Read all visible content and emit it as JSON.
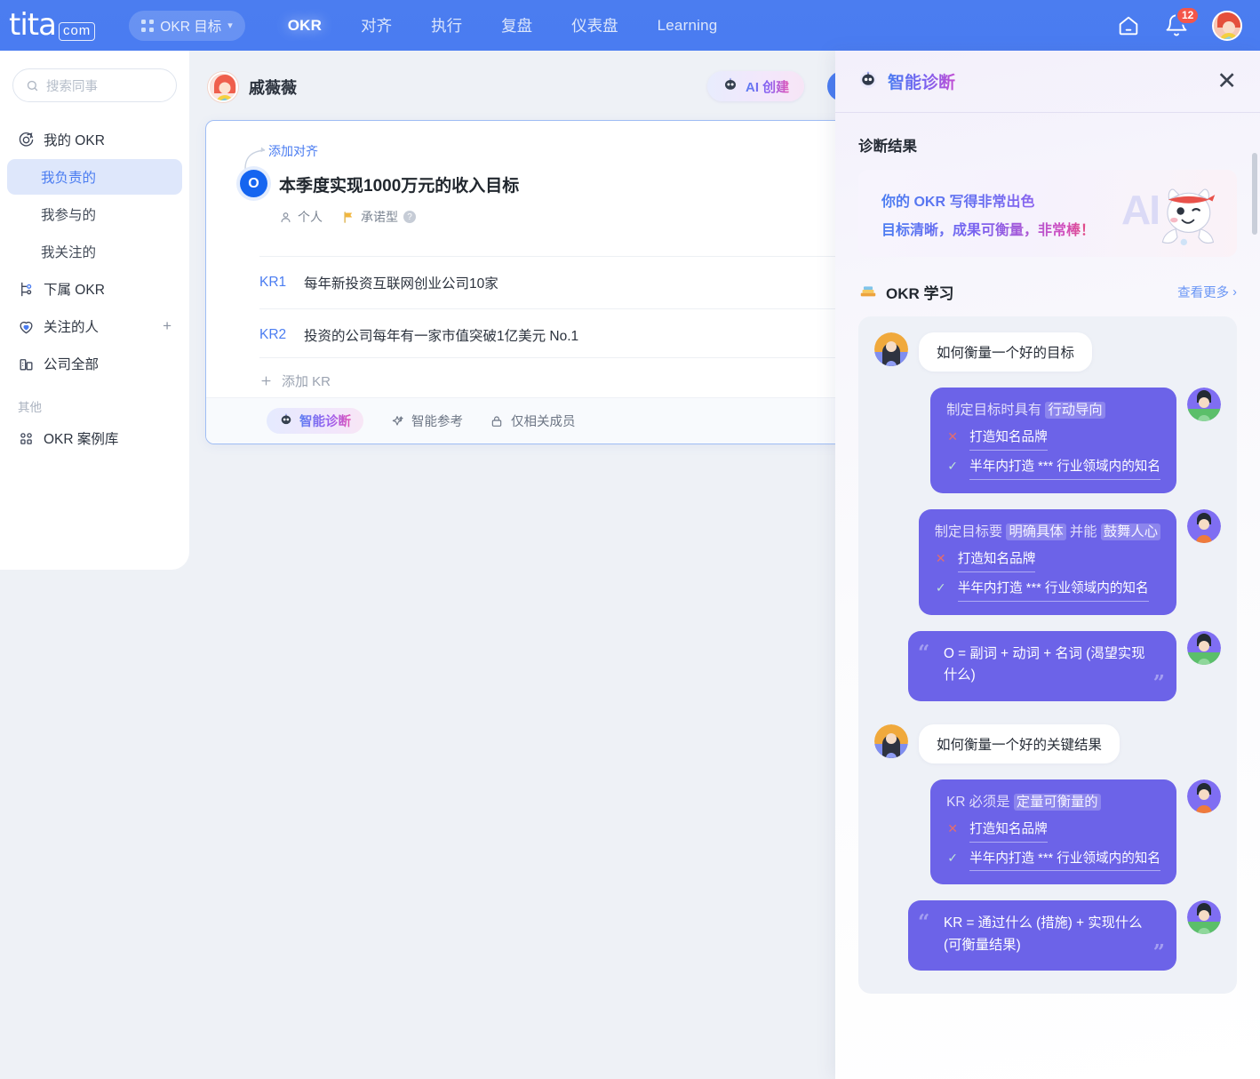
{
  "topnav": {
    "logo_word": "tita",
    "logo_com": "com",
    "okr_target_chip": "OKR 目标",
    "links": [
      {
        "label": "OKR",
        "active": true,
        "latin": true
      },
      {
        "label": "对齐",
        "active": false,
        "latin": false
      },
      {
        "label": "执行",
        "active": false,
        "latin": false
      },
      {
        "label": "复盘",
        "active": false,
        "latin": false
      },
      {
        "label": "仪表盘",
        "active": false,
        "latin": false
      },
      {
        "label": "Learning",
        "active": false,
        "latin": true
      }
    ],
    "notification_count": "12"
  },
  "sidebar": {
    "search_placeholder": "搜索同事",
    "items": [
      {
        "label": "我的 OKR",
        "icon": "target-icon",
        "sub": false,
        "active": false
      },
      {
        "label": "我负责的",
        "icon": "",
        "sub": true,
        "active": true
      },
      {
        "label": "我参与的",
        "icon": "",
        "sub": true,
        "active": false
      },
      {
        "label": "我关注的",
        "icon": "",
        "sub": true,
        "active": false
      },
      {
        "label": "下属 OKR",
        "icon": "org-tree-icon",
        "sub": false,
        "active": false
      },
      {
        "label": "关注的人",
        "icon": "heart-shield-icon",
        "sub": false,
        "active": false,
        "plus": "+"
      },
      {
        "label": "公司全部",
        "icon": "building-icon",
        "sub": false,
        "active": false
      }
    ],
    "section_other": "其他",
    "other_items": [
      {
        "label": "OKR 案例库",
        "icon": "grid-icon"
      }
    ]
  },
  "main": {
    "owner_name": "戚薇薇",
    "ai_create_label": "AI 创建",
    "card": {
      "add_align": "添加对齐",
      "o_badge": "O",
      "objective": "本季度实现1000万元的收入目标",
      "meta": [
        {
          "icon": "person-icon",
          "label": "个人"
        },
        {
          "icon": "flag-icon",
          "label": "承诺型",
          "help": "?"
        }
      ],
      "krs": [
        {
          "tag": "KR1",
          "text": "每年新投资互联网创业公司10家"
        },
        {
          "tag": "KR2",
          "text": "投资的公司每年有一家市值突破1亿美元 No.1"
        }
      ],
      "add_kr": "添加 KR",
      "footer": [
        {
          "label": "智能诊断",
          "icon": "robot-icon",
          "highlight": true
        },
        {
          "label": "智能参考",
          "icon": "sparkle-icon",
          "highlight": false
        },
        {
          "label": "仅相关成员",
          "icon": "lock-icon",
          "highlight": false
        }
      ]
    }
  },
  "panel": {
    "title": "智能诊断",
    "close": "✕",
    "result_title": "诊断结果",
    "diagnosis": {
      "line1": "你的 OKR 写得非常出色",
      "line2": "目标清晰，成果可衡量，非常棒！",
      "ghost_text": "AI"
    },
    "learning": {
      "title": "OKR 学习",
      "more": "查看更多",
      "chat": [
        {
          "type": "question",
          "text": "如何衡量一个好的目标"
        },
        {
          "type": "answer",
          "headline_pre": "制定目标时具有 ",
          "headline_hl": "行动导向",
          "headline_post": "",
          "items": [
            {
              "mark": "x",
              "text": "打造知名品牌"
            },
            {
              "mark": "v",
              "text": "半年内打造 *** 行业领域内的知名"
            }
          ]
        },
        {
          "type": "answer",
          "headline_pre": "制定目标要 ",
          "headline_hl": "明确具体",
          "headline_mid": " 并能 ",
          "headline_hl2": "鼓舞人心",
          "items": [
            {
              "mark": "x",
              "text": "打造知名品牌"
            },
            {
              "mark": "v",
              "text": "半年内打造 *** 行业领域内的知名"
            }
          ]
        },
        {
          "type": "quote",
          "text": "O = 副词 + 动词 + 名词 (渴望实现什么)"
        },
        {
          "type": "question",
          "text": "如何衡量一个好的关键结果"
        },
        {
          "type": "answer",
          "headline_pre": "KR 必须是 ",
          "headline_hl": "定量可衡量的",
          "items": [
            {
              "mark": "x",
              "text": "打造知名品牌"
            },
            {
              "mark": "v",
              "text": "半年内打造 *** 行业领域内的知名"
            }
          ]
        },
        {
          "type": "quote",
          "text": "KR = 通过什么 (措施) + 实现什么 (可衡量结果)"
        }
      ]
    }
  },
  "colors": {
    "nav_blue": "#4a7cf1",
    "accent_purple": "#6c63e8",
    "badge_red": "#f4564a",
    "panel_bg": "#f7f6fc"
  }
}
